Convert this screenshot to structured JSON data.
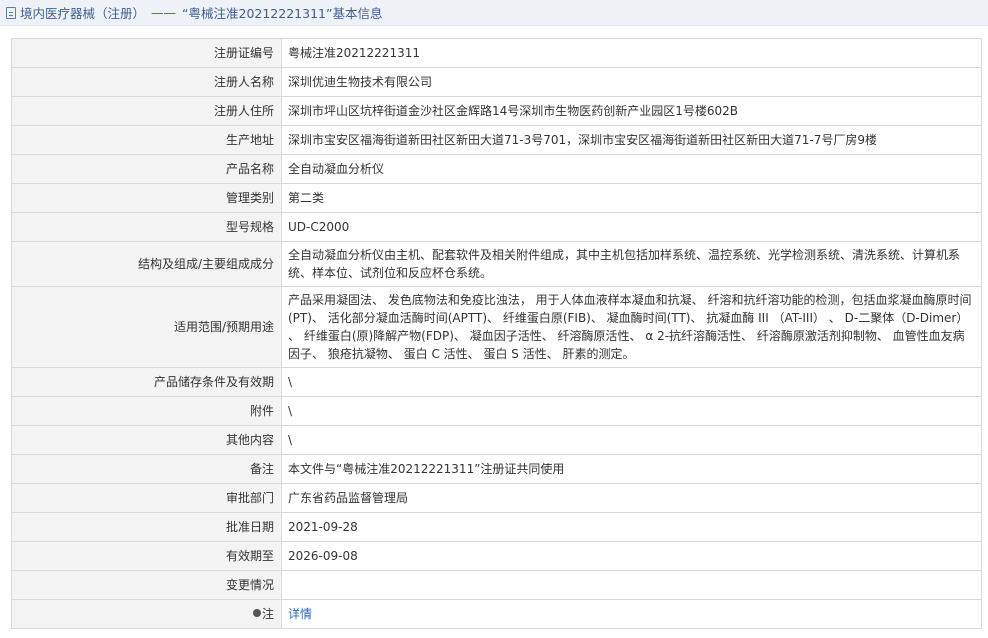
{
  "header": {
    "section": "境内医疗器械（注册）",
    "separator": "——",
    "title": "“粤械注准20212221311”基本信息"
  },
  "rows": [
    {
      "label": "注册证编号",
      "value": "粤械注准20212221311"
    },
    {
      "label": "注册人名称",
      "value": "深圳优迪生物技术有限公司"
    },
    {
      "label": "注册人住所",
      "value": "深圳市坪山区坑梓街道金沙社区金辉路14号深圳市生物医药创新产业园区1号楼602B"
    },
    {
      "label": "生产地址",
      "value": "深圳市宝安区福海街道新田社区新田大道71-3号701，深圳市宝安区福海街道新田社区新田大道71-7号厂房9楼"
    },
    {
      "label": "产品名称",
      "value": "全自动凝血分析仪"
    },
    {
      "label": "管理类别",
      "value": "第二类"
    },
    {
      "label": "型号规格",
      "value": "UD-C2000"
    },
    {
      "label": "结构及组成/主要组成成分",
      "value": "全自动凝血分析仪由主机、配套软件及相关附件组成，其中主机包括加样系统、温控系统、光学检测系统、清洗系统、计算机系统、样本位、试剂位和反应杯仓系统。"
    },
    {
      "label": "适用范围/预期用途",
      "value": "产品采用凝固法、 发色底物法和免疫比浊法， 用于人体血液样本凝血和抗凝、 纤溶和抗纤溶功能的检测，包括血浆凝血酶原时间(PT)、 活化部分凝血活酶时间(APTT)、 纤维蛋白原(FIB)、 凝血酶时间(TT)、 抗凝血酶 III （AT-III） 、 D-二聚体（D-Dimer） 、 纤维蛋白(原)降解产物(FDP)、 凝血因子活性、 纤溶酶原活性、 α 2-抗纤溶酶活性、 纤溶酶原激活剂抑制物、 血管性血友病因子、 狼疮抗凝物、 蛋白 C 活性、 蛋白 S 活性、 肝素的测定。"
    },
    {
      "label": "产品储存条件及有效期",
      "value": "\\"
    },
    {
      "label": "附件",
      "value": "\\"
    },
    {
      "label": "其他内容",
      "value": "\\"
    },
    {
      "label": "备注",
      "value": "本文件与“粤械注准20212221311”注册证共同使用"
    },
    {
      "label": "审批部门",
      "value": "广东省药品监督管理局"
    },
    {
      "label": "批准日期",
      "value": "2021-09-28"
    },
    {
      "label": "有效期至",
      "value": "2026-09-08"
    },
    {
      "label": "变更情况",
      "value": ""
    }
  ],
  "note": {
    "label": "注",
    "link": "详情"
  }
}
